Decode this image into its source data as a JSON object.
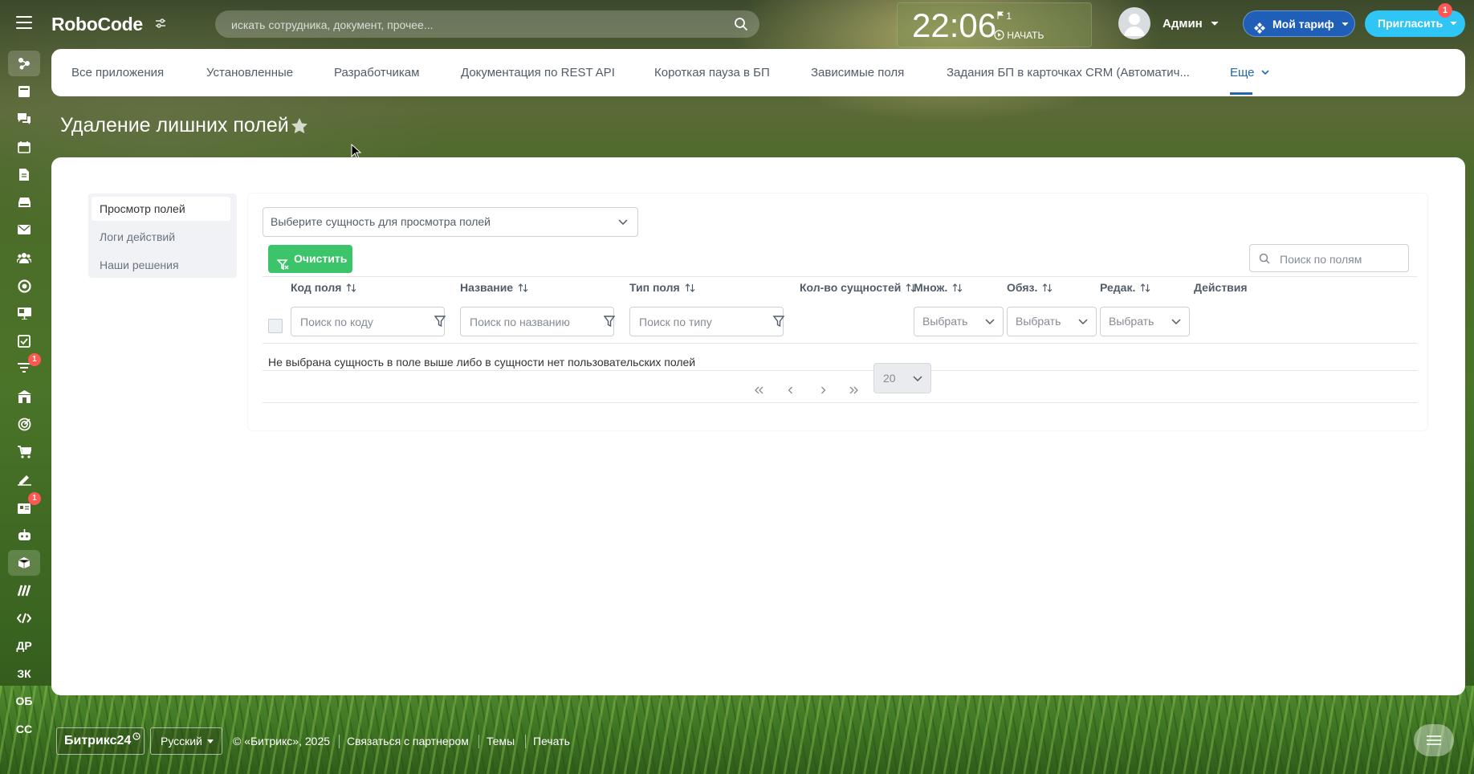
{
  "header": {
    "logo": "RoboCode",
    "search_placeholder": "искать сотрудника, документ, прочее...",
    "clock": {
      "time": "22:06",
      "flag_count": "1",
      "start_label": "НАЧАТЬ"
    },
    "user_name": "Админ",
    "tariff_label": "Мой тариф",
    "invite_label": "Пригласить",
    "invite_badge": "1"
  },
  "sidebar": {
    "items": [
      {
        "icon": "connections-icon"
      },
      {
        "icon": "feed-icon"
      },
      {
        "icon": "chat-icon"
      },
      {
        "icon": "calendar-icon"
      },
      {
        "icon": "documents-icon"
      },
      {
        "icon": "drive-icon"
      },
      {
        "icon": "mail-icon"
      },
      {
        "icon": "groups-icon"
      },
      {
        "icon": "crm-icon"
      },
      {
        "icon": "sites-icon"
      },
      {
        "icon": "tasks-icon"
      },
      {
        "icon": "filter-funnel-icon",
        "badge": "1"
      },
      {
        "icon": "company-icon"
      },
      {
        "icon": "target-icon"
      },
      {
        "icon": "cart-icon"
      },
      {
        "icon": "sign-icon"
      },
      {
        "icon": "inbox-icon",
        "badge": "1"
      },
      {
        "icon": "robot-icon"
      },
      {
        "icon": "box-icon"
      },
      {
        "icon": "stripes-icon"
      },
      {
        "icon": "code-icon"
      }
    ],
    "text_items": [
      "ДР",
      "ЗК",
      "ОБ",
      "СС"
    ]
  },
  "nav": {
    "items": [
      "Все приложения",
      "Установленные",
      "Разработчикам",
      "Документация по REST API",
      "Короткая пауза в БП",
      "Зависимые поля",
      "Задания БП в карточках CRM (Автоматич..."
    ],
    "more_label": "Еще"
  },
  "page": {
    "title": "Удаление лишних полей"
  },
  "left_menu": {
    "items": [
      "Просмотр полей",
      "Логи действий",
      "Наши решения"
    ],
    "active_index": 0
  },
  "content": {
    "entity_select_placeholder": "Выберите сущность для просмотра полей",
    "clear_label": "Очистить",
    "fields_search_placeholder": "Поиск по полям",
    "columns": [
      "Код поля",
      "Название",
      "Тип поля",
      "Кол-во сущностей",
      "Множ.",
      "Обяз.",
      "Редак.",
      "Действия"
    ],
    "filters": {
      "code_placeholder": "Поиск по коду",
      "name_placeholder": "Поиск по названию",
      "type_placeholder": "Поиск по типу",
      "select_label": "Выбрать"
    },
    "empty_message": "Не выбрана сущность в поле выше либо в сущности нет пользовательских полей",
    "page_size": "20"
  },
  "footer": {
    "brand": "Битрикс24",
    "language": "Русский",
    "copyright": "© «Битрикс», 2025",
    "links": [
      "Связаться с партнером",
      "Темы",
      "Печать"
    ]
  },
  "colors": {
    "accent_blue": "#2067b0",
    "tariff_button": "#1f5fb8",
    "invite_button": "#2fc6f6",
    "clear_button": "#3bc46a",
    "badge_red": "#ff5752"
  }
}
